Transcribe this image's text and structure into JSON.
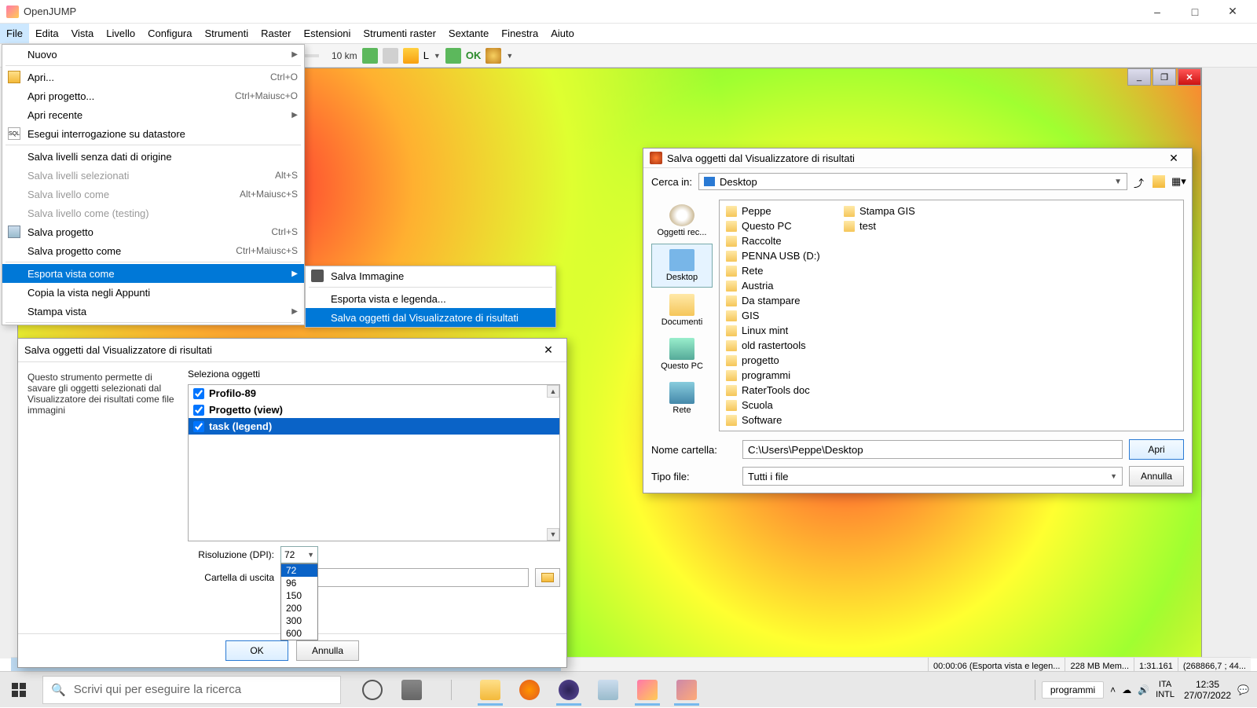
{
  "app": {
    "title": "OpenJUMP"
  },
  "menubar": [
    "File",
    "Edita",
    "Vista",
    "Livello",
    "Configura",
    "Strumenti",
    "Raster",
    "Estensioni",
    "Strumenti raster",
    "Sextante",
    "Finestra",
    "Aiuto"
  ],
  "toolbar": {
    "scale": "10 km",
    "ok": "OK",
    "l": "L"
  },
  "file_menu": {
    "items": [
      {
        "label": "Nuovo",
        "arrow": true
      },
      {
        "sep": true
      },
      {
        "label": "Apri...",
        "shortcut": "Ctrl+O",
        "icon": "open"
      },
      {
        "label": "Apri progetto...",
        "shortcut": "Ctrl+Maiusc+O"
      },
      {
        "label": "Apri recente",
        "arrow": true
      },
      {
        "label": "Esegui interrogazione su datastore",
        "icon": "sql"
      },
      {
        "sep": true
      },
      {
        "label": "Salva livelli senza dati di origine"
      },
      {
        "label": "Salva livelli selezionati",
        "shortcut": "Alt+S",
        "disabled": true
      },
      {
        "label": "Salva livello come",
        "shortcut": "Alt+Maiusc+S",
        "disabled": true
      },
      {
        "label": "Salva livello come (testing)",
        "disabled": true
      },
      {
        "label": "Salva progetto",
        "shortcut": "Ctrl+S",
        "icon": "save"
      },
      {
        "label": "Salva progetto come",
        "shortcut": "Ctrl+Maiusc+S"
      },
      {
        "sep": true
      },
      {
        "label": "Esporta vista come",
        "arrow": true,
        "highlighted": true
      },
      {
        "label": "Copia la vista negli Appunti"
      },
      {
        "label": "Stampa vista",
        "arrow": true
      },
      {
        "sep": true
      }
    ]
  },
  "sub_menu": {
    "items": [
      {
        "label": "Salva Immagine",
        "icon": "camera"
      },
      {
        "sep": true
      },
      {
        "label": "Esporta vista e legenda..."
      },
      {
        "label": "Salva oggetti dal Visualizzatore di risultati",
        "highlighted": true
      }
    ]
  },
  "dialog1": {
    "title": "Salva oggetti dal Visualizzatore di risultati",
    "desc": "Questo strumento permette di savare gli oggetti selezionati dal Visualizzatore dei risultati come file immagini",
    "select_label": "Seleziona oggetti",
    "items": [
      {
        "label": "Profilo-89",
        "checked": true,
        "bold": true
      },
      {
        "label": "Progetto (view)",
        "checked": true,
        "bold": true
      },
      {
        "label": "task (legend)",
        "checked": true,
        "bold": true,
        "selected": true
      }
    ],
    "dpi_label": "Risoluzione (DPI):",
    "dpi_value": "72",
    "dpi_options": [
      "72",
      "96",
      "150",
      "200",
      "300",
      "600"
    ],
    "out_label": "Cartella di uscita",
    "ok": "OK",
    "cancel": "Annulla"
  },
  "dialog2": {
    "title": "Salva oggetti dal Visualizzatore di risultati",
    "lookin_label": "Cerca in:",
    "lookin_value": "Desktop",
    "places": [
      {
        "label": "Oggetti rec...",
        "kind": "recent"
      },
      {
        "label": "Desktop",
        "kind": "desktop",
        "active": true
      },
      {
        "label": "Documenti",
        "kind": "docs"
      },
      {
        "label": "Questo PC",
        "kind": "pc"
      },
      {
        "label": "Rete",
        "kind": "net"
      }
    ],
    "files_col1": [
      "Peppe",
      "Questo PC",
      "Raccolte",
      "PENNA USB (D:)",
      "Rete",
      "Austria",
      "Da stampare",
      "GIS",
      "Linux mint",
      "old rastertools",
      "progetto",
      "programmi"
    ],
    "files_col2": [
      "RaterTools doc",
      "Scuola",
      "Software",
      "Stampa GIS",
      "test"
    ],
    "name_label": "Nome cartella:",
    "name_value": "C:\\Users\\Peppe\\Desktop",
    "type_label": "Tipo file:",
    "type_value": "Tutti i file",
    "open": "Apri",
    "cancel": "Annulla"
  },
  "status": {
    "time": "00:00:06 (Esporta vista e legen...",
    "mem": "228 MB Mem...",
    "scale": "1:31.161",
    "coord": "(268866,7 ; 44..."
  },
  "taskbar": {
    "search_placeholder": "Scrivi qui per eseguire la ricerca",
    "pill": "programmi",
    "lang1": "ITA",
    "lang2": "INTL",
    "time": "12:35",
    "date": "27/07/2022"
  }
}
